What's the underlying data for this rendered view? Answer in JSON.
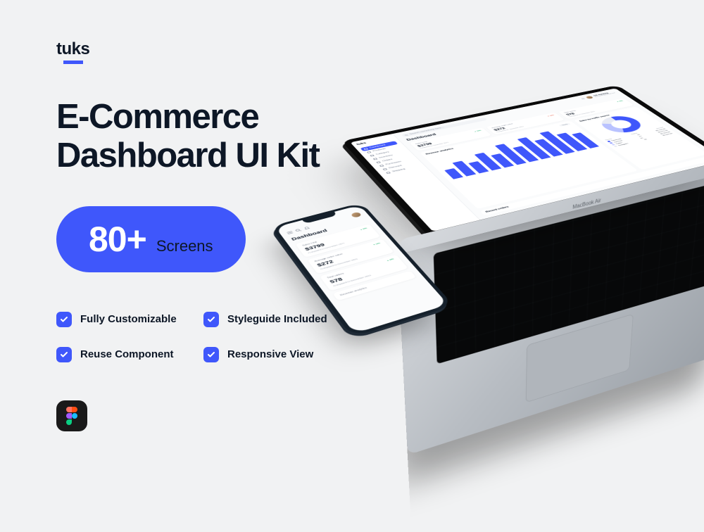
{
  "brand": {
    "name": "tuks"
  },
  "headline": "E-Commerce Dashboard UI Kit",
  "pill": {
    "count": "80+",
    "label": "Screens"
  },
  "features": [
    "Fully Customizable",
    "Styleguide Included",
    "Reuse Component",
    "Responsive View"
  ],
  "tool_icon": "figma",
  "laptop": {
    "device_label": "MacBook Air",
    "app": {
      "logo": "tuks",
      "search_placeholder": "Search something here...",
      "user": {
        "name": "Arfi Ganteng",
        "email": "ArfiGanteng@gmail.com"
      },
      "page_title": "Dashboard",
      "sidebar": [
        {
          "label": "Dashboard",
          "active": true
        },
        {
          "label": "Products",
          "active": false
        },
        {
          "label": "Category",
          "active": false
        },
        {
          "label": "Inventory",
          "active": false
        },
        {
          "label": "Orders",
          "active": false
        },
        {
          "label": "Purchases",
          "active": false
        },
        {
          "label": "Discount",
          "active": false
        },
        {
          "label": "Shipping",
          "active": false
        }
      ],
      "stats": [
        {
          "label": "Sales total",
          "value": "$3799",
          "trend": "▲ 34%",
          "trend_dir": "up",
          "sub": "Compared to December 2021"
        },
        {
          "label": "Average order value",
          "value": "$272",
          "trend": "▼ 12%",
          "trend_dir": "down",
          "sub": "Compared to December 2021"
        },
        {
          "label": "Total orders",
          "value": "578",
          "trend": "▲ 44%",
          "trend_dir": "up",
          "sub": "Compared to December 2021"
        }
      ],
      "chart": {
        "title": "Revenue analytics",
        "filter_label": "Yearly",
        "bars_heights": [
          38,
          58,
          44,
          70,
          54,
          86,
          64,
          92,
          72,
          98,
          78,
          66
        ]
      },
      "traffic": {
        "title": "Sales by traffic source",
        "legend_headers": {
          "left": "Source",
          "right": "Orders"
        },
        "data": [
          {
            "source": "Facebook",
            "orders": "22",
            "amount": "$2,742.00",
            "color": "#3f57fb"
          },
          {
            "source": "YouTube",
            "orders": "27",
            "amount": "$3,272.00",
            "color": "#8a98ff"
          },
          {
            "source": "Twitter",
            "orders": "10",
            "amount": "$2,303.00",
            "color": "#c7ceff"
          },
          {
            "source": "Instagram",
            "orders": "25",
            "amount": "$2,922.00",
            "color": "#e7eaf3"
          }
        ]
      },
      "recent_title": "Recent orders"
    }
  },
  "phone": {
    "page_title": "Dashboard",
    "stats": [
      {
        "label": "Sales total",
        "value": "$3799",
        "trend": "▲ 34%",
        "sub": "Compared to December 2021"
      },
      {
        "label": "Average order value",
        "value": "$272",
        "trend": "▼ 12%",
        "sub": "Compared to December 2021"
      },
      {
        "label": "Total orders",
        "value": "578",
        "trend": "▲ 44%",
        "sub": "Compared to December 2021"
      }
    ],
    "revenue_title": "Revenue analytics"
  },
  "colors": {
    "accent": "#3f57fb",
    "dark": "#0d1726",
    "bg": "#f1f2f3"
  }
}
